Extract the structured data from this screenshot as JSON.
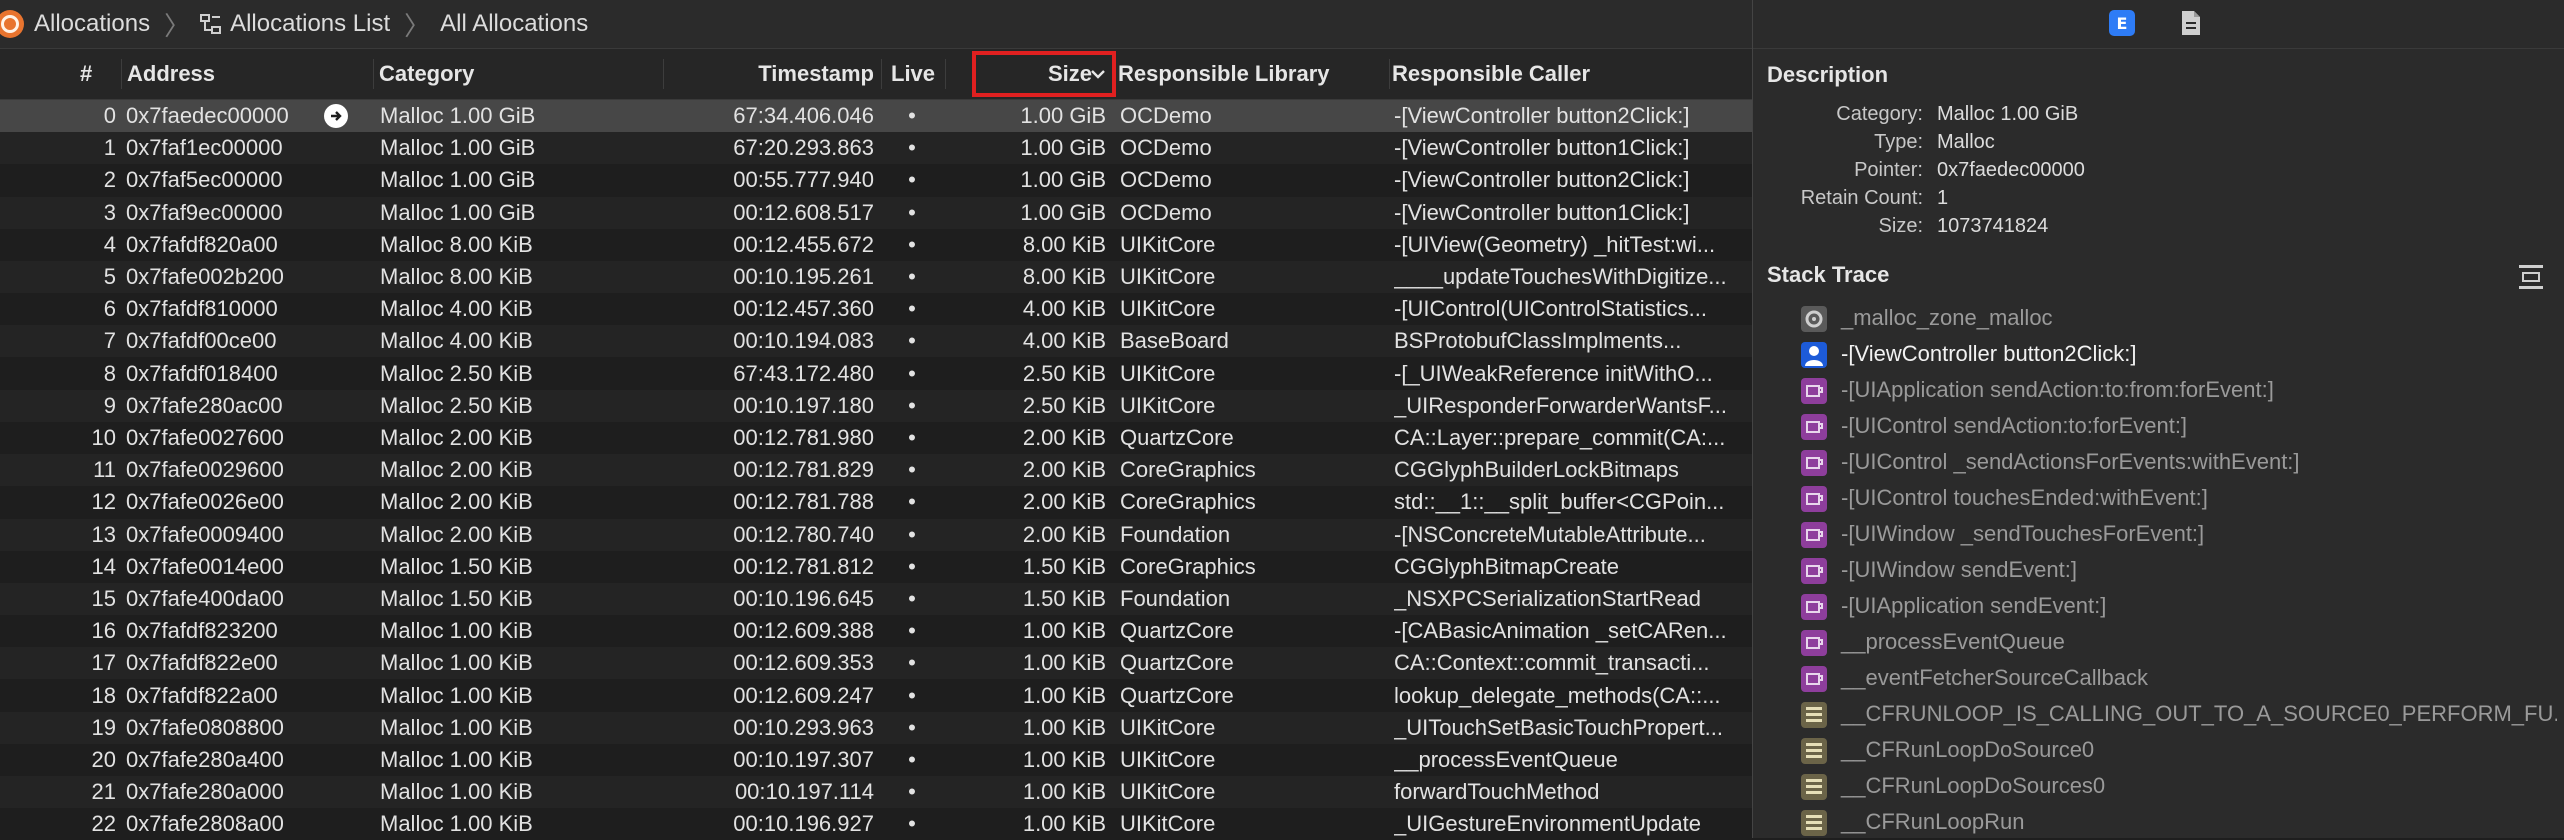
{
  "breadcrumb": {
    "app": "Allocations",
    "list": "Allocations List",
    "current": "All Allocations"
  },
  "columns": {
    "num": "#",
    "address": "Address",
    "category": "Category",
    "timestamp": "Timestamp",
    "live": "Live",
    "size": "Size",
    "library": "Responsible Library",
    "caller": "Responsible Caller"
  },
  "rows": [
    {
      "num": "0",
      "address": "0x7faedec00000",
      "category": "Malloc 1.00 GiB",
      "timestamp": "67:34.406.046",
      "live": "•",
      "size": "1.00 GiB",
      "library": "OCDemo",
      "caller": "-[ViewController button2Click:]"
    },
    {
      "num": "1",
      "address": "0x7faf1ec00000",
      "category": "Malloc 1.00 GiB",
      "timestamp": "67:20.293.863",
      "live": "•",
      "size": "1.00 GiB",
      "library": "OCDemo",
      "caller": "-[ViewController button1Click:]"
    },
    {
      "num": "2",
      "address": "0x7faf5ec00000",
      "category": "Malloc 1.00 GiB",
      "timestamp": "00:55.777.940",
      "live": "•",
      "size": "1.00 GiB",
      "library": "OCDemo",
      "caller": "-[ViewController button2Click:]"
    },
    {
      "num": "3",
      "address": "0x7faf9ec00000",
      "category": "Malloc 1.00 GiB",
      "timestamp": "00:12.608.517",
      "live": "•",
      "size": "1.00 GiB",
      "library": "OCDemo",
      "caller": "-[ViewController button1Click:]"
    },
    {
      "num": "4",
      "address": "0x7fafdf820a00",
      "category": "Malloc 8.00 KiB",
      "timestamp": "00:12.455.672",
      "live": "•",
      "size": "8.00 KiB",
      "library": "UIKitCore",
      "caller": "-[UIView(Geometry) _hitTest:wi..."
    },
    {
      "num": "5",
      "address": "0x7fafe002b200",
      "category": "Malloc 8.00 KiB",
      "timestamp": "00:10.195.261",
      "live": "•",
      "size": "8.00 KiB",
      "library": "UIKitCore",
      "caller": "____updateTouchesWithDigitize..."
    },
    {
      "num": "6",
      "address": "0x7fafdf810000",
      "category": "Malloc 4.00 KiB",
      "timestamp": "00:12.457.360",
      "live": "•",
      "size": "4.00 KiB",
      "library": "UIKitCore",
      "caller": "-[UIControl(UIControlStatistics..."
    },
    {
      "num": "7",
      "address": "0x7fafdf00ce00",
      "category": "Malloc 4.00 KiB",
      "timestamp": "00:10.194.083",
      "live": "•",
      "size": "4.00 KiB",
      "library": "BaseBoard",
      "caller": "BSProtobufClassImplments..."
    },
    {
      "num": "8",
      "address": "0x7fafdf018400",
      "category": "Malloc 2.50 KiB",
      "timestamp": "67:43.172.480",
      "live": "•",
      "size": "2.50 KiB",
      "library": "UIKitCore",
      "caller": "-[_UIWeakReference initWithO..."
    },
    {
      "num": "9",
      "address": "0x7fafe280ac00",
      "category": "Malloc 2.50 KiB",
      "timestamp": "00:10.197.180",
      "live": "•",
      "size": "2.50 KiB",
      "library": "UIKitCore",
      "caller": "_UIResponderForwarderWantsF..."
    },
    {
      "num": "10",
      "address": "0x7fafe0027600",
      "category": "Malloc 2.00 KiB",
      "timestamp": "00:12.781.980",
      "live": "•",
      "size": "2.00 KiB",
      "library": "QuartzCore",
      "caller": "CA::Layer::prepare_commit(CA:..."
    },
    {
      "num": "11",
      "address": "0x7fafe0029600",
      "category": "Malloc 2.00 KiB",
      "timestamp": "00:12.781.829",
      "live": "•",
      "size": "2.00 KiB",
      "library": "CoreGraphics",
      "caller": "CGGlyphBuilderLockBitmaps"
    },
    {
      "num": "12",
      "address": "0x7fafe0026e00",
      "category": "Malloc 2.00 KiB",
      "timestamp": "00:12.781.788",
      "live": "•",
      "size": "2.00 KiB",
      "library": "CoreGraphics",
      "caller": "std::__1::__split_buffer<CGPoin..."
    },
    {
      "num": "13",
      "address": "0x7fafe0009400",
      "category": "Malloc 2.00 KiB",
      "timestamp": "00:12.780.740",
      "live": "•",
      "size": "2.00 KiB",
      "library": "Foundation",
      "caller": "-[NSConcreteMutableAttribute..."
    },
    {
      "num": "14",
      "address": "0x7fafe0014e00",
      "category": "Malloc 1.50 KiB",
      "timestamp": "00:12.781.812",
      "live": "•",
      "size": "1.50 KiB",
      "library": "CoreGraphics",
      "caller": "CGGlyphBitmapCreate"
    },
    {
      "num": "15",
      "address": "0x7fafe400da00",
      "category": "Malloc 1.50 KiB",
      "timestamp": "00:10.196.645",
      "live": "•",
      "size": "1.50 KiB",
      "library": "Foundation",
      "caller": "_NSXPCSerializationStartRead"
    },
    {
      "num": "16",
      "address": "0x7fafdf823200",
      "category": "Malloc 1.00 KiB",
      "timestamp": "00:12.609.388",
      "live": "•",
      "size": "1.00 KiB",
      "library": "QuartzCore",
      "caller": "-[CABasicAnimation _setCARen..."
    },
    {
      "num": "17",
      "address": "0x7fafdf822e00",
      "category": "Malloc 1.00 KiB",
      "timestamp": "00:12.609.353",
      "live": "•",
      "size": "1.00 KiB",
      "library": "QuartzCore",
      "caller": "CA::Context::commit_transacti..."
    },
    {
      "num": "18",
      "address": "0x7fafdf822a00",
      "category": "Malloc 1.00 KiB",
      "timestamp": "00:12.609.247",
      "live": "•",
      "size": "1.00 KiB",
      "library": "QuartzCore",
      "caller": "lookup_delegate_methods(CA::..."
    },
    {
      "num": "19",
      "address": "0x7fafe0808800",
      "category": "Malloc 1.00 KiB",
      "timestamp": "00:10.293.963",
      "live": "•",
      "size": "1.00 KiB",
      "library": "UIKitCore",
      "caller": "_UITouchSetBasicTouchPropert..."
    },
    {
      "num": "20",
      "address": "0x7fafe280a400",
      "category": "Malloc 1.00 KiB",
      "timestamp": "00:10.197.307",
      "live": "•",
      "size": "1.00 KiB",
      "library": "UIKitCore",
      "caller": "__processEventQueue"
    },
    {
      "num": "21",
      "address": "0x7fafe280a000",
      "category": "Malloc 1.00 KiB",
      "timestamp": "00:10.197.114",
      "live": "•",
      "size": "1.00 KiB",
      "library": "UIKitCore",
      "caller": "forwardTouchMethod"
    },
    {
      "num": "22",
      "address": "0x7fafe2808a00",
      "category": "Malloc 1.00 KiB",
      "timestamp": "00:10.196.927",
      "live": "•",
      "size": "1.00 KiB",
      "library": "UIKitCore",
      "caller": "_UIGestureEnvironmentUpdate"
    }
  ],
  "inspector": {
    "tab_extended_letter": "E",
    "description_title": "Description",
    "description": [
      {
        "label": "Category:",
        "value": "Malloc 1.00 GiB"
      },
      {
        "label": "Type:",
        "value": "Malloc"
      },
      {
        "label": "Pointer:",
        "value": "0x7faedec00000"
      },
      {
        "label": "Retain Count:",
        "value": "1"
      },
      {
        "label": "Size:",
        "value": "1073741824"
      }
    ],
    "stack_title": "Stack Trace",
    "stack": [
      {
        "icon": "gear",
        "text": "_malloc_zone_malloc"
      },
      {
        "icon": "user",
        "text": "-[ViewController button2Click:]"
      },
      {
        "icon": "objc",
        "text": "-[UIApplication sendAction:to:from:forEvent:]"
      },
      {
        "icon": "objc",
        "text": "-[UIControl sendAction:to:forEvent:]"
      },
      {
        "icon": "objc",
        "text": "-[UIControl _sendActionsForEvents:withEvent:]"
      },
      {
        "icon": "objc",
        "text": "-[UIControl touchesEnded:withEvent:]"
      },
      {
        "icon": "objc",
        "text": "-[UIWindow _sendTouchesForEvent:]"
      },
      {
        "icon": "objc",
        "text": "-[UIWindow sendEvent:]"
      },
      {
        "icon": "objc",
        "text": "-[UIApplication sendEvent:]"
      },
      {
        "icon": "objc",
        "text": "__processEventQueue"
      },
      {
        "icon": "objc",
        "text": "__eventFetcherSourceCallback"
      },
      {
        "icon": "cf",
        "text": "__CFRUNLOOP_IS_CALLING_OUT_TO_A_SOURCE0_PERFORM_FU..."
      },
      {
        "icon": "cf",
        "text": "__CFRunLoopDoSource0"
      },
      {
        "icon": "cf",
        "text": "__CFRunLoopDoSources0"
      },
      {
        "icon": "cf",
        "text": "__CFRunLoopRun"
      }
    ]
  }
}
